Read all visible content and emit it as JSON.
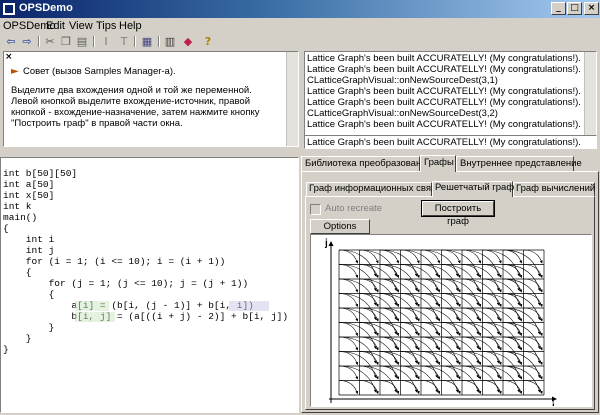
{
  "window": {
    "title": "OPSDemo",
    "min": "_",
    "max": "□",
    "close": "×"
  },
  "menu": [
    "OPSDemo",
    "Edit",
    "View",
    "Tips",
    "Help"
  ],
  "toolbar_icons": [
    "back-arrow-icon",
    "forward-arrow-icon",
    "cut-icon",
    "copy-icon",
    "paste-icon",
    "cursor-icon",
    "text-icon",
    "grid-icon",
    "list-icon",
    "book-icon",
    "help-icon"
  ],
  "tip": {
    "close": "×",
    "title": "Совет (вызов Samples Manager-а).",
    "text": "Выделите два вхождения одной и той же переменной. Левой кнопкой выделите вхождение-источник, правой кнопкой - вхождение-назначение, затем нажмите кнопку \"Построить граф\" в правой части окна."
  },
  "log": {
    "lines": [
      "Lattice Graph's been built ACCURATELLY! (My congratulations!).",
      "Lattice Graph's been built ACCURATELLY! (My congratulations!).",
      "CLatticeGraphVisual::onNewSourceDest(3,1)",
      "Lattice Graph's been built ACCURATELLY! (My congratulations!).",
      "Lattice Graph's been built ACCURATELLY! (My congratulations!).",
      "CLatticeGraphVisual::onNewSourceDest(3,2)",
      "Lattice Graph's been built ACCURATELLY! (My congratulations!)."
    ],
    "last": "Lattice Graph's been built ACCURATELLY! (My congratulations!)."
  },
  "code": [
    "int b[50][50]",
    "int a[50]",
    "int x[50]",
    "int k",
    "main()",
    "{",
    "    int i",
    "    int j",
    "    for (i = 1; (i <= 10); i = (i + 1))",
    "    {",
    "        for (j = 1; (j <= 10); j = (j + 1))",
    "        {",
    "            a[i] = (b[i, (j - 1)] + b[i, i])",
    "            b[i, j] = (a[((i + j) - 2)] + b[i, j])",
    "        }",
    "    }",
    "}"
  ],
  "tabs": [
    "Библиотека преобразований",
    "Графы",
    "Внутреннее представление"
  ],
  "subtabs": [
    "Граф информационных связей",
    "Решетчатый граф",
    "Граф вычислений"
  ],
  "auto_recreate": "Auto recreate",
  "build_button": "Построить граф",
  "options_button": "Options",
  "axis": {
    "y": "j",
    "x": "i"
  },
  "grid": {
    "cols": 10,
    "rows": 10
  }
}
